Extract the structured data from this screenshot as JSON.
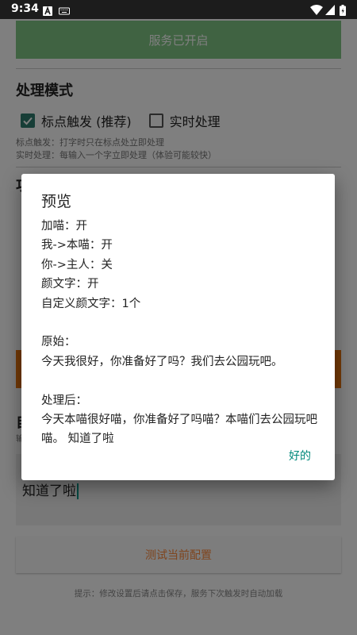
{
  "status_bar": {
    "time": "9:34"
  },
  "service_button": {
    "label": "服务已开启"
  },
  "mode": {
    "title": "处理模式",
    "options": [
      {
        "label": "标点触发 (推荐)",
        "checked": true
      },
      {
        "label": "实时处理",
        "checked": false
      }
    ],
    "hints": [
      "标点触发：打字时只在标点处立即处理",
      "实时处理：每输入一个字立即处理（体验可能较快）"
    ]
  },
  "partial_labels": {
    "behind_dialog_1": "功",
    "behind_dialog_2": "自",
    "behind_dialog_3": "输"
  },
  "input": {
    "value": "知道了啦"
  },
  "test_button": {
    "label": "测试当前配置"
  },
  "footer_hint": "提示：修改设置后请点击保存，服务下次触发时自动加载",
  "dialog": {
    "title": "预览",
    "lines": [
      "加喵：开",
      "我->本喵：开",
      "你->主人：关",
      "颜文字：开",
      "自定义颜文字：1个",
      "",
      "原始：",
      "今天我很好，你准备好了吗？我们去公园玩吧。",
      "",
      "处理后：",
      "今天本喵很好喵，你准备好了吗喵？本喵们去公园玩吧喵。 知道了啦"
    ],
    "ok_label": "好的"
  },
  "colors": {
    "accent": "#2e7d6e",
    "service_button": "#81c784",
    "orange": "#e8740c",
    "dialog_ok": "#00897b"
  }
}
